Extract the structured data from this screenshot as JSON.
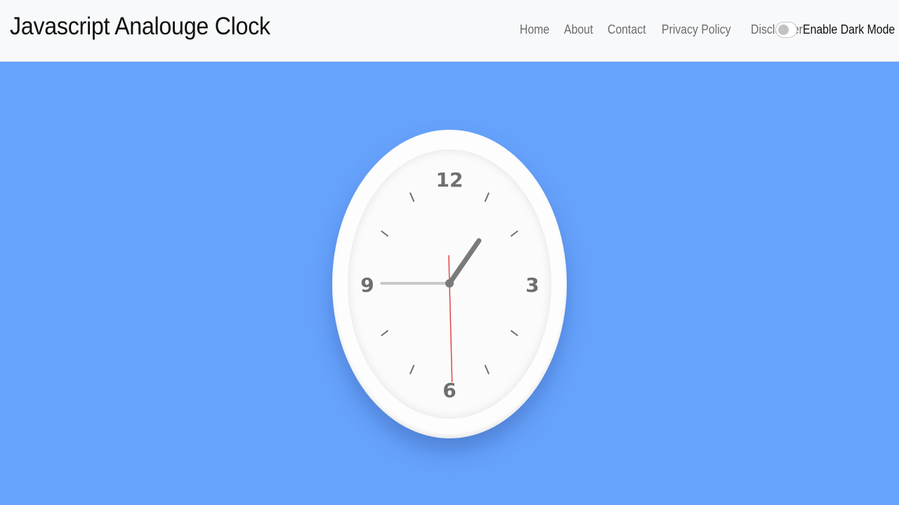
{
  "header": {
    "brand": "Javascript Analouge Clock",
    "nav": [
      {
        "label": "Home"
      },
      {
        "label": "About"
      },
      {
        "label": "Contact"
      },
      {
        "label": "Privacy Policy"
      },
      {
        "label": "Disclaimer"
      }
    ],
    "dark_mode": {
      "label": "Enable Dark Mode",
      "enabled": false
    }
  },
  "colors": {
    "header_bg": "#f8f9fa",
    "page_bg": "#66a3fd",
    "clock_bg": "#fdfdfd",
    "hand_color": "#7a7a7a",
    "minute_hand_color": "#c8c8c8",
    "second_hand_color": "#e04646"
  },
  "clock": {
    "numerals": [
      "12",
      "3",
      "6",
      "9"
    ],
    "time": {
      "hour": 1,
      "minute": 45,
      "second": 32
    }
  }
}
